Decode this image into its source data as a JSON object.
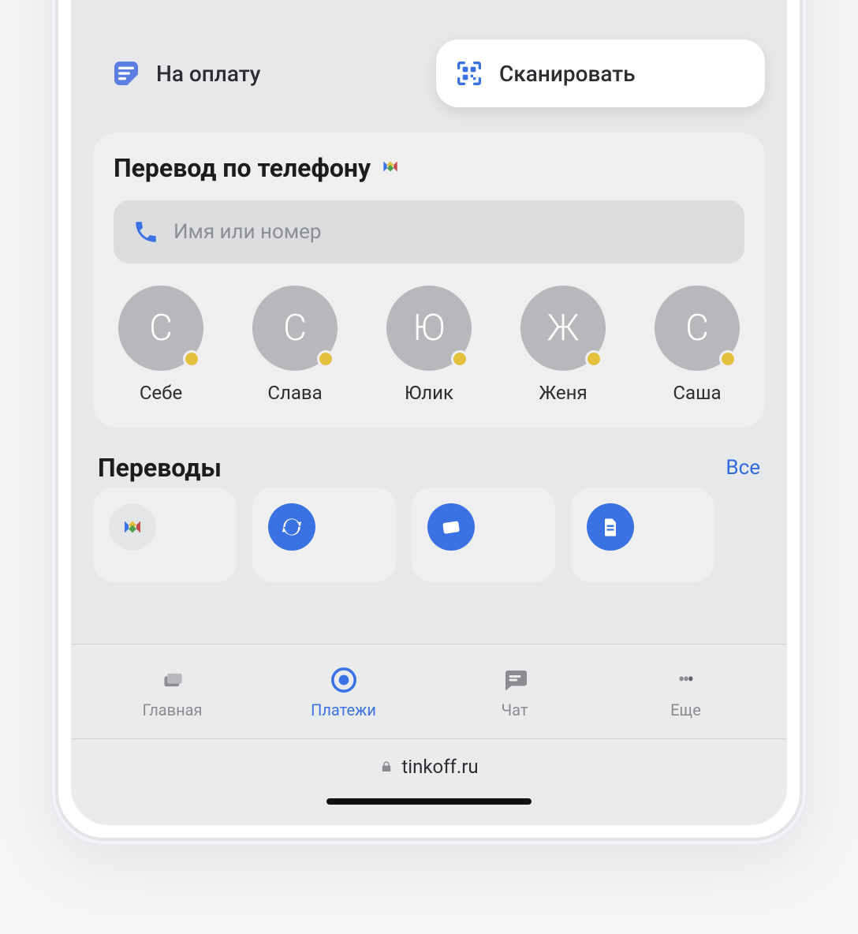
{
  "chips": {
    "pay": "На оплату",
    "scan": "Сканировать"
  },
  "phone_transfer": {
    "title": "Перевод по телефону",
    "placeholder": "Имя или номер"
  },
  "contacts": [
    {
      "initial": "С",
      "name": "Себе"
    },
    {
      "initial": "С",
      "name": "Слава"
    },
    {
      "initial": "Ю",
      "name": "Юлик"
    },
    {
      "initial": "Ж",
      "name": "Женя"
    },
    {
      "initial": "С",
      "name": "Саша"
    }
  ],
  "transfers": {
    "title": "Переводы",
    "all": "Все"
  },
  "tabs": {
    "home": "Главная",
    "payments": "Платежи",
    "chat": "Чат",
    "more": "Еще"
  },
  "browser": {
    "url": "tinkoff.ru"
  }
}
